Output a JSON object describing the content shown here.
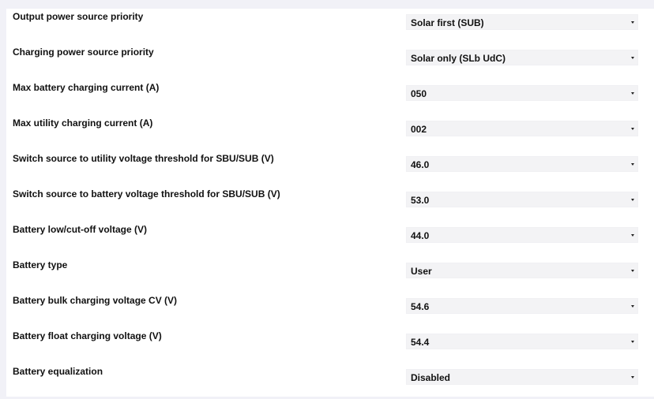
{
  "settings": [
    {
      "label": "Output power source priority",
      "value": "Solar first (SUB)"
    },
    {
      "label": "Charging power source priority",
      "value": "Solar only (SLb UdC)"
    },
    {
      "label": "Max battery charging current (A)",
      "value": "050"
    },
    {
      "label": "Max utility charging current (A)",
      "value": "002"
    },
    {
      "label": "Switch source to utility voltage threshold for SBU/SUB (V)",
      "value": "46.0"
    },
    {
      "label": "Switch source to battery voltage threshold for SBU/SUB (V)",
      "value": "53.0"
    },
    {
      "label": "Battery low/cut-off voltage (V)",
      "value": "44.0"
    },
    {
      "label": "Battery type",
      "value": "User"
    },
    {
      "label": "Battery bulk charging voltage CV (V)",
      "value": "54.6"
    },
    {
      "label": "Battery float charging voltage (V)",
      "value": "54.4"
    },
    {
      "label": "Battery equalization",
      "value": "Disabled"
    }
  ],
  "icons": {
    "dropdown": "chevron-down-icon"
  }
}
